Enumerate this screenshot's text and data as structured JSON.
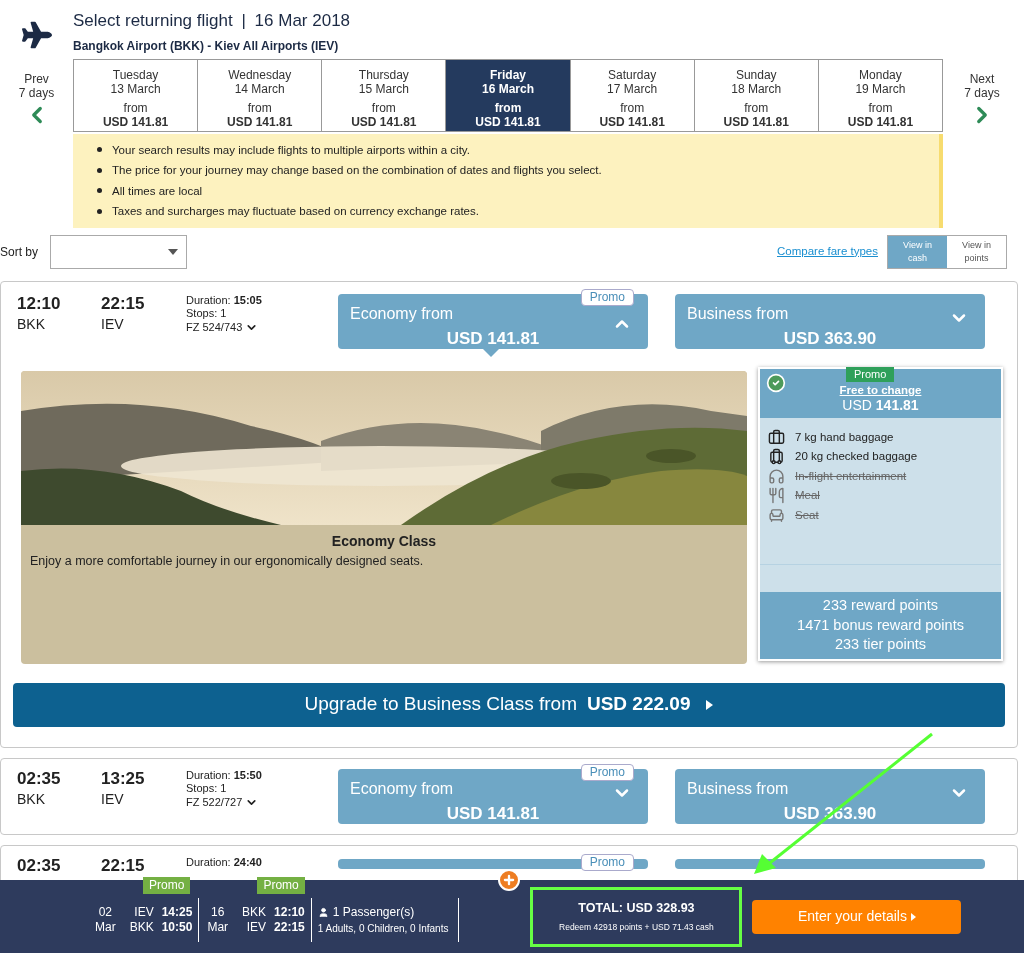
{
  "header": {
    "title": "Select returning flight",
    "separator": "|",
    "date": "16 Mar 2018",
    "route": "Bangkok Airport (BKK) - Kiev All Airports (IEV)"
  },
  "date_nav": {
    "prev": {
      "label": "Prev",
      "sub": "7 days"
    },
    "next": {
      "label": "Next",
      "sub": "7 days"
    },
    "days": [
      {
        "weekday": "Tuesday",
        "date": "13 March",
        "from": "from",
        "price": "USD 141.81",
        "selected": false
      },
      {
        "weekday": "Wednesday",
        "date": "14 March",
        "from": "from",
        "price": "USD 141.81",
        "selected": false
      },
      {
        "weekday": "Thursday",
        "date": "15 March",
        "from": "from",
        "price": "USD 141.81",
        "selected": false
      },
      {
        "weekday": "Friday",
        "date": "16 March",
        "from": "from",
        "price": "USD 141.81",
        "selected": true
      },
      {
        "weekday": "Saturday",
        "date": "17 March",
        "from": "from",
        "price": "USD 141.81",
        "selected": false
      },
      {
        "weekday": "Sunday",
        "date": "18 March",
        "from": "from",
        "price": "USD 141.81",
        "selected": false
      },
      {
        "weekday": "Monday",
        "date": "19 March",
        "from": "from",
        "price": "USD 141.81",
        "selected": false
      }
    ]
  },
  "notices": [
    "Your search results may include flights to multiple airports within a city.",
    "The price for your journey may change based on the combination of dates and flights you select.",
    "All times are local",
    "Taxes and surcharges may fluctuate based on currency exchange rates."
  ],
  "sort": {
    "label": "Sort by"
  },
  "compare_link": "Compare fare types",
  "view_toggle": [
    {
      "label": "View in cash",
      "selected": true
    },
    {
      "label": "View in points",
      "selected": false
    }
  ],
  "flights": [
    {
      "depart_time": "12:10",
      "depart_airport": "BKK",
      "arrive_time": "22:15",
      "arrive_airport": "IEV",
      "duration_label": "Duration:",
      "duration": "15:05",
      "stops": "Stops: 1",
      "flight_no": "FZ 524/743",
      "economy": {
        "label": "Economy from",
        "price": "USD 141.81",
        "promo": "Promo",
        "expanded": true
      },
      "business": {
        "label": "Business from",
        "price": "USD 363.90",
        "expanded": false
      },
      "details": {
        "class_title": "Economy Class",
        "description": "Enjoy a more comfortable journey in our ergonomically designed seats.",
        "fare": {
          "selected": true,
          "promo": "Promo",
          "link": "Free to change",
          "currency": "USD",
          "amount": "141.81",
          "features": [
            {
              "kind": "hand",
              "text": "7 kg hand baggage",
              "included": true
            },
            {
              "kind": "checked",
              "text": "20 kg checked baggage",
              "included": true
            },
            {
              "kind": "entertainment",
              "text": "In-flight entertainment",
              "included": false
            },
            {
              "kind": "meal",
              "text": "Meal",
              "included": false
            },
            {
              "kind": "seat",
              "text": "Seat",
              "included": false
            }
          ],
          "points": [
            "233 reward points",
            "1471 bonus reward points",
            "233 tier points"
          ]
        },
        "upgrade": {
          "label": "Upgrade to Business Class from",
          "price": "USD 222.09"
        }
      }
    },
    {
      "depart_time": "02:35",
      "depart_airport": "BKK",
      "arrive_time": "13:25",
      "arrive_airport": "IEV",
      "duration_label": "Duration:",
      "duration": "15:50",
      "stops": "Stops: 1",
      "flight_no": "FZ 522/727",
      "economy": {
        "label": "Economy from",
        "price": "USD 141.81",
        "promo": "Promo",
        "expanded": false
      },
      "business": {
        "label": "Business from",
        "price": "USD 363.90",
        "expanded": false
      }
    },
    {
      "depart_time": "02:35",
      "arrive_time": "22:15",
      "duration_label": "Duration:",
      "duration": "24:40",
      "economy": {
        "promo": "Promo",
        "partial": true
      },
      "business": {
        "partial": true
      }
    }
  ],
  "summary": {
    "legs": [
      {
        "promo": "Promo",
        "day": "02",
        "month": "Mar",
        "from": "IEV",
        "to": "BKK",
        "depart": "14:25",
        "arrive": "10:50"
      },
      {
        "promo": "Promo",
        "day": "16",
        "month": "Mar",
        "from": "BKK",
        "to": "IEV",
        "depart": "12:10",
        "arrive": "22:15"
      }
    ],
    "passengers": {
      "title": "1 Passenger(s)",
      "detail": "1 Adults, 0 Children, 0 Infants"
    },
    "total": "TOTAL: USD 328.93",
    "redeem": "Redeem 42918 points + USD 71.43 cash",
    "cta": "Enter your details"
  }
}
